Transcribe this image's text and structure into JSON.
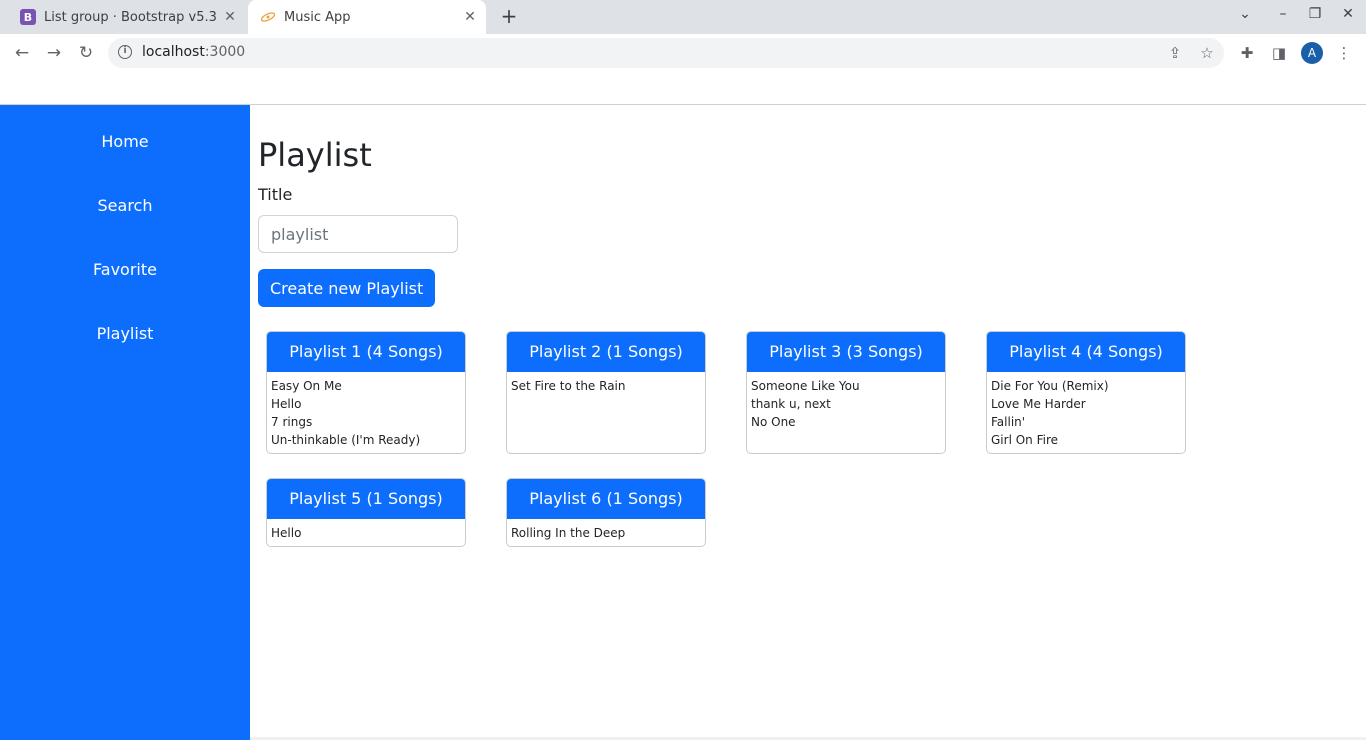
{
  "browser": {
    "tabs": [
      {
        "title": "List group · Bootstrap v5.3",
        "favicon": "bootstrap-icon",
        "active": false
      },
      {
        "title": "Music App",
        "favicon": "react-icon",
        "active": true
      }
    ],
    "url_host": "localhost",
    "url_port": ":3000",
    "profile_initial": "A"
  },
  "sidebar": {
    "items": [
      {
        "label": "Home"
      },
      {
        "label": "Search"
      },
      {
        "label": "Favorite"
      },
      {
        "label": "Playlist"
      }
    ]
  },
  "main": {
    "title": "Playlist",
    "input_label": "Title",
    "input_placeholder": "playlist",
    "input_value": "",
    "create_button": "Create new Playlist",
    "playlists": [
      {
        "header": "Playlist 1 (4 Songs)",
        "songs": [
          "Easy On Me",
          "Hello",
          "7 rings",
          "Un-thinkable (I'm Ready)"
        ]
      },
      {
        "header": "Playlist 2 (1 Songs)",
        "songs": [
          "Set Fire to the Rain"
        ]
      },
      {
        "header": "Playlist 3 (3 Songs)",
        "songs": [
          "Someone Like You",
          "thank u, next",
          "No One"
        ]
      },
      {
        "header": "Playlist 4 (4 Songs)",
        "songs": [
          "Die For You (Remix)",
          "Love Me Harder",
          "Fallin'",
          "Girl On Fire"
        ]
      },
      {
        "header": "Playlist 5 (1 Songs)",
        "songs": [
          "Hello"
        ]
      },
      {
        "header": "Playlist 6 (1 Songs)",
        "songs": [
          "Rolling In the Deep"
        ]
      }
    ]
  },
  "colors": {
    "primary": "#0d6efd",
    "text": "#212529"
  }
}
